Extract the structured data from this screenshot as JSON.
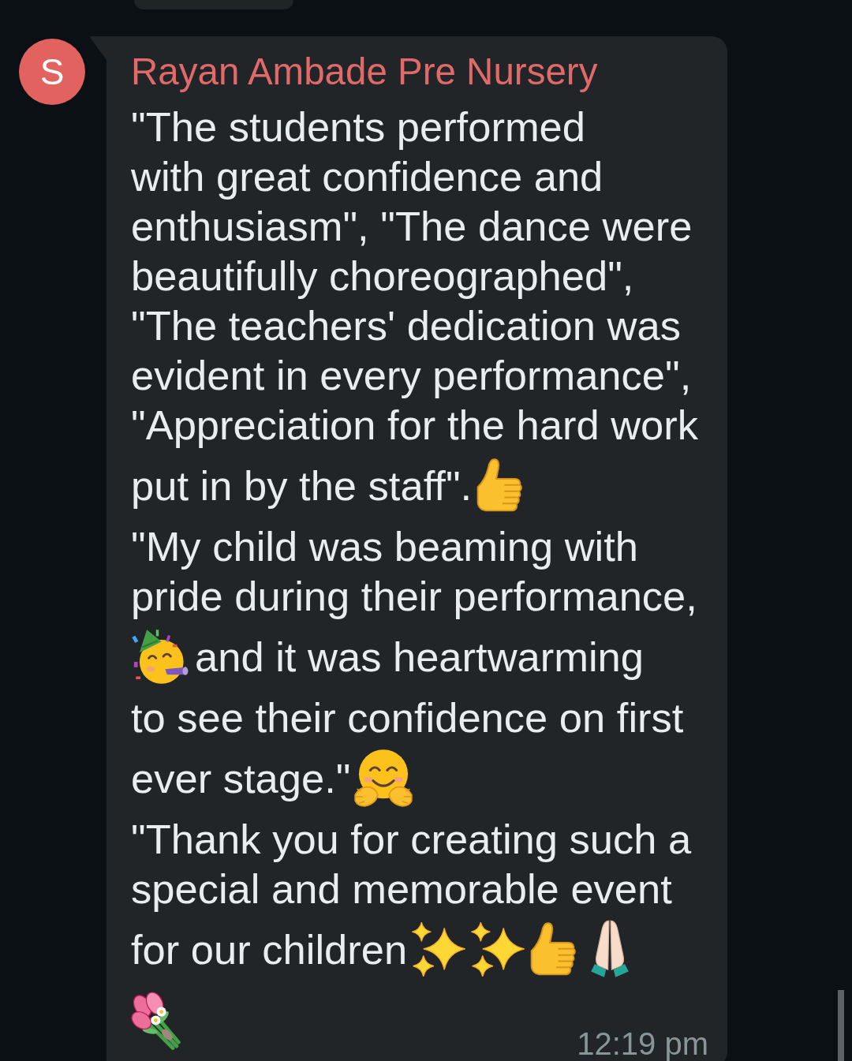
{
  "message": {
    "avatar": {
      "initial": "S"
    },
    "sender": "Rayan Ambade Pre Nursery",
    "rows": [
      {
        "parts": [
          {
            "kind": "text",
            "text": "\"The students performed\nwith great confidence and\nenthusiasm\", \"The dance were\nbeautifully choreographed\",\n\"The teachers' dedication was\nevident in every performance\",\n\"Appreciation for the hard work"
          }
        ]
      },
      {
        "parts": [
          {
            "kind": "text",
            "text": "put in by the staff\"."
          },
          {
            "kind": "thumbsup"
          }
        ]
      },
      {
        "parts": [
          {
            "kind": "text",
            "text": "\"My child was beaming with\npride during their performance,"
          }
        ]
      },
      {
        "parts": [
          {
            "kind": "partyface"
          },
          {
            "kind": "text",
            "text": "and it was heartwarming"
          }
        ]
      },
      {
        "parts": [
          {
            "kind": "text",
            "text": "to see their confidence on first"
          }
        ]
      },
      {
        "parts": [
          {
            "kind": "text",
            "text": "ever stage.\""
          },
          {
            "kind": "hug"
          }
        ]
      },
      {
        "parts": [
          {
            "kind": "text",
            "text": "\"Thank you for creating such a\nspecial and memorable event"
          }
        ]
      },
      {
        "parts": [
          {
            "kind": "text",
            "text": "for our children"
          },
          {
            "kind": "sparkles"
          },
          {
            "kind": "sparkles"
          },
          {
            "kind": "thumbsup"
          },
          {
            "kind": "pray"
          }
        ]
      },
      {
        "parts": [
          {
            "kind": "bouquet"
          }
        ]
      }
    ],
    "time": "12:19 pm"
  }
}
